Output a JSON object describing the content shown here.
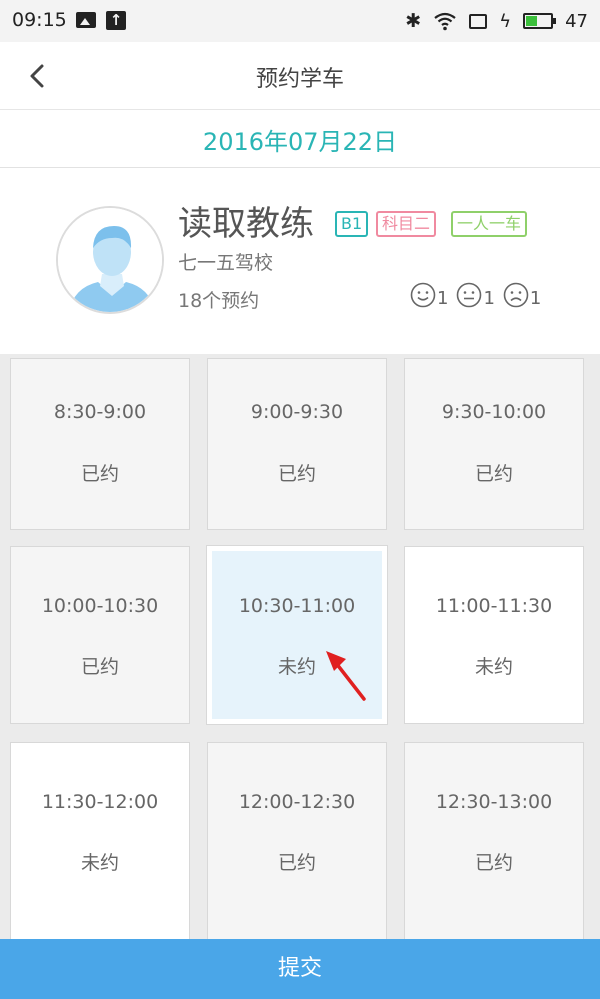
{
  "status_bar": {
    "time": "09:15",
    "battery": "47"
  },
  "nav": {
    "title": "预约学车"
  },
  "date": "2016年07月22日",
  "coach": {
    "name": "读取教练",
    "badges": [
      "B1",
      "科目二",
      "一人一车"
    ],
    "school": "七一五驾校",
    "appointments": "18个预约",
    "ratings": [
      {
        "icon": "smile-face-icon",
        "count": "1"
      },
      {
        "icon": "neutral-face-icon",
        "count": "1"
      },
      {
        "icon": "sad-face-icon",
        "count": "1"
      }
    ]
  },
  "slots": [
    {
      "time": "8:30-9:00",
      "status": "已约",
      "state": "booked"
    },
    {
      "time": "9:00-9:30",
      "status": "已约",
      "state": "booked"
    },
    {
      "time": "9:30-10:00",
      "status": "已约",
      "state": "booked"
    },
    {
      "time": "10:00-10:30",
      "status": "已约",
      "state": "booked"
    },
    {
      "time": "10:30-11:00",
      "status": "未约",
      "state": "selected"
    },
    {
      "time": "11:00-11:30",
      "status": "未约",
      "state": "free"
    },
    {
      "time": "11:30-12:00",
      "status": "未约",
      "state": "free"
    },
    {
      "time": "12:00-12:30",
      "status": "已约",
      "state": "booked"
    },
    {
      "time": "12:30-13:00",
      "status": "已约",
      "state": "booked"
    }
  ],
  "colors": {
    "accent": "#2ab5b5",
    "submit": "#4aa6e8",
    "selected": "#e6f3fb",
    "arrow": "#e02020"
  },
  "submit_label": "提交"
}
